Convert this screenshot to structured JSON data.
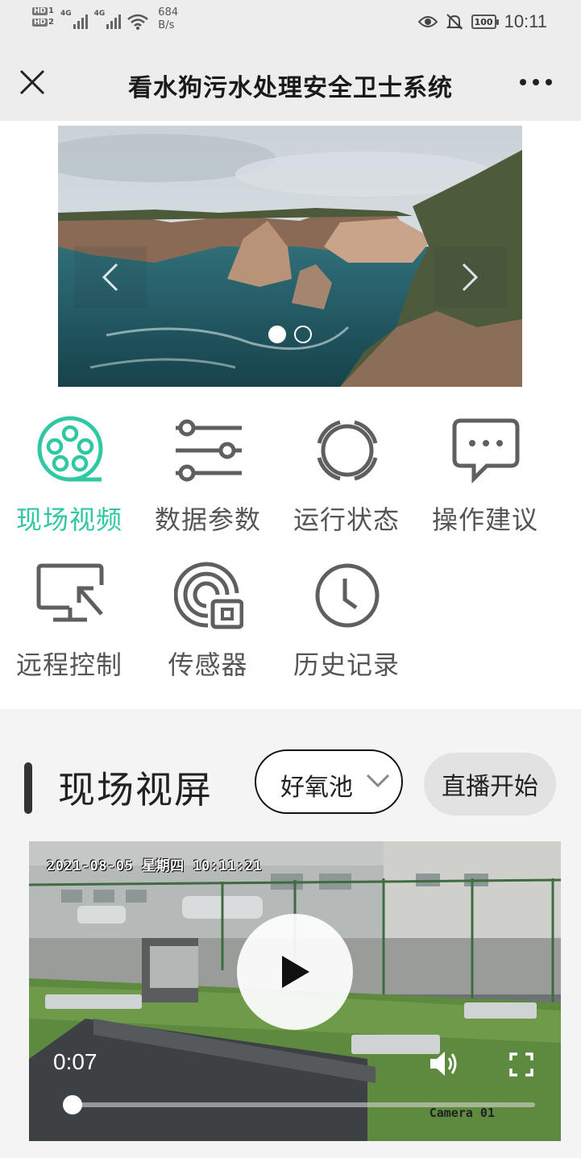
{
  "status_bar": {
    "hd1": "HD",
    "hd1_num": "1",
    "hd2": "HD",
    "hd2_num": "2",
    "net1": "4G",
    "net2": "4G",
    "speed_value": "684",
    "speed_unit": "B/s",
    "battery": "100",
    "time": "10:11"
  },
  "header": {
    "title": "看水狗污水处理安全卫士系统",
    "close_icon": "close-icon",
    "more_icon": "more-icon"
  },
  "carousel": {
    "slide_count": 2,
    "active_index": 0
  },
  "menu": [
    {
      "label": "现场视频",
      "icon": "film-reel-icon",
      "active": true
    },
    {
      "label": "数据参数",
      "icon": "sliders-icon",
      "active": false
    },
    {
      "label": "运行状态",
      "icon": "ring-status-icon",
      "active": false
    },
    {
      "label": "操作建议",
      "icon": "chat-bubble-icon",
      "active": false
    },
    {
      "label": "远程控制",
      "icon": "monitor-cursor-icon",
      "active": false
    },
    {
      "label": "传感器",
      "icon": "sensor-icon",
      "active": false
    },
    {
      "label": "历史记录",
      "icon": "clock-icon",
      "active": false
    }
  ],
  "section": {
    "title": "现场视屏",
    "select_value": "好氧池",
    "live_button": "直播开始"
  },
  "video": {
    "osd_timestamp": "2021-08-05 星期四 10:11:21",
    "camera_label": "Camera 01",
    "current_time": "0:07",
    "progress": 0.02
  },
  "colors": {
    "accent": "#2fc8a2",
    "icon_gray": "#5f5f5f"
  }
}
